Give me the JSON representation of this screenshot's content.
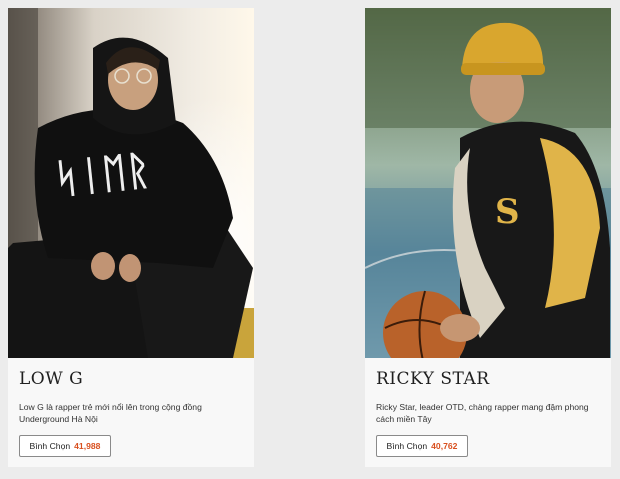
{
  "cards": [
    {
      "name": "LOW G",
      "description": "Low G là rapper trẻ mới nổi lên trong cộng đồng Underground Hà Nội",
      "vote_label": "Bình Chọn",
      "vote_count": "41,988"
    },
    {
      "name": "RICKY STAR",
      "description": "Ricky Star, leader OTD, chàng rapper mang đậm phong cách miền Tây",
      "vote_label": "Bình Chọn",
      "vote_count": "40,762"
    }
  ],
  "colors": {
    "page_bg": "#ececec",
    "card_bg": "#f8f8f8",
    "vote_count": "#d9501f"
  }
}
